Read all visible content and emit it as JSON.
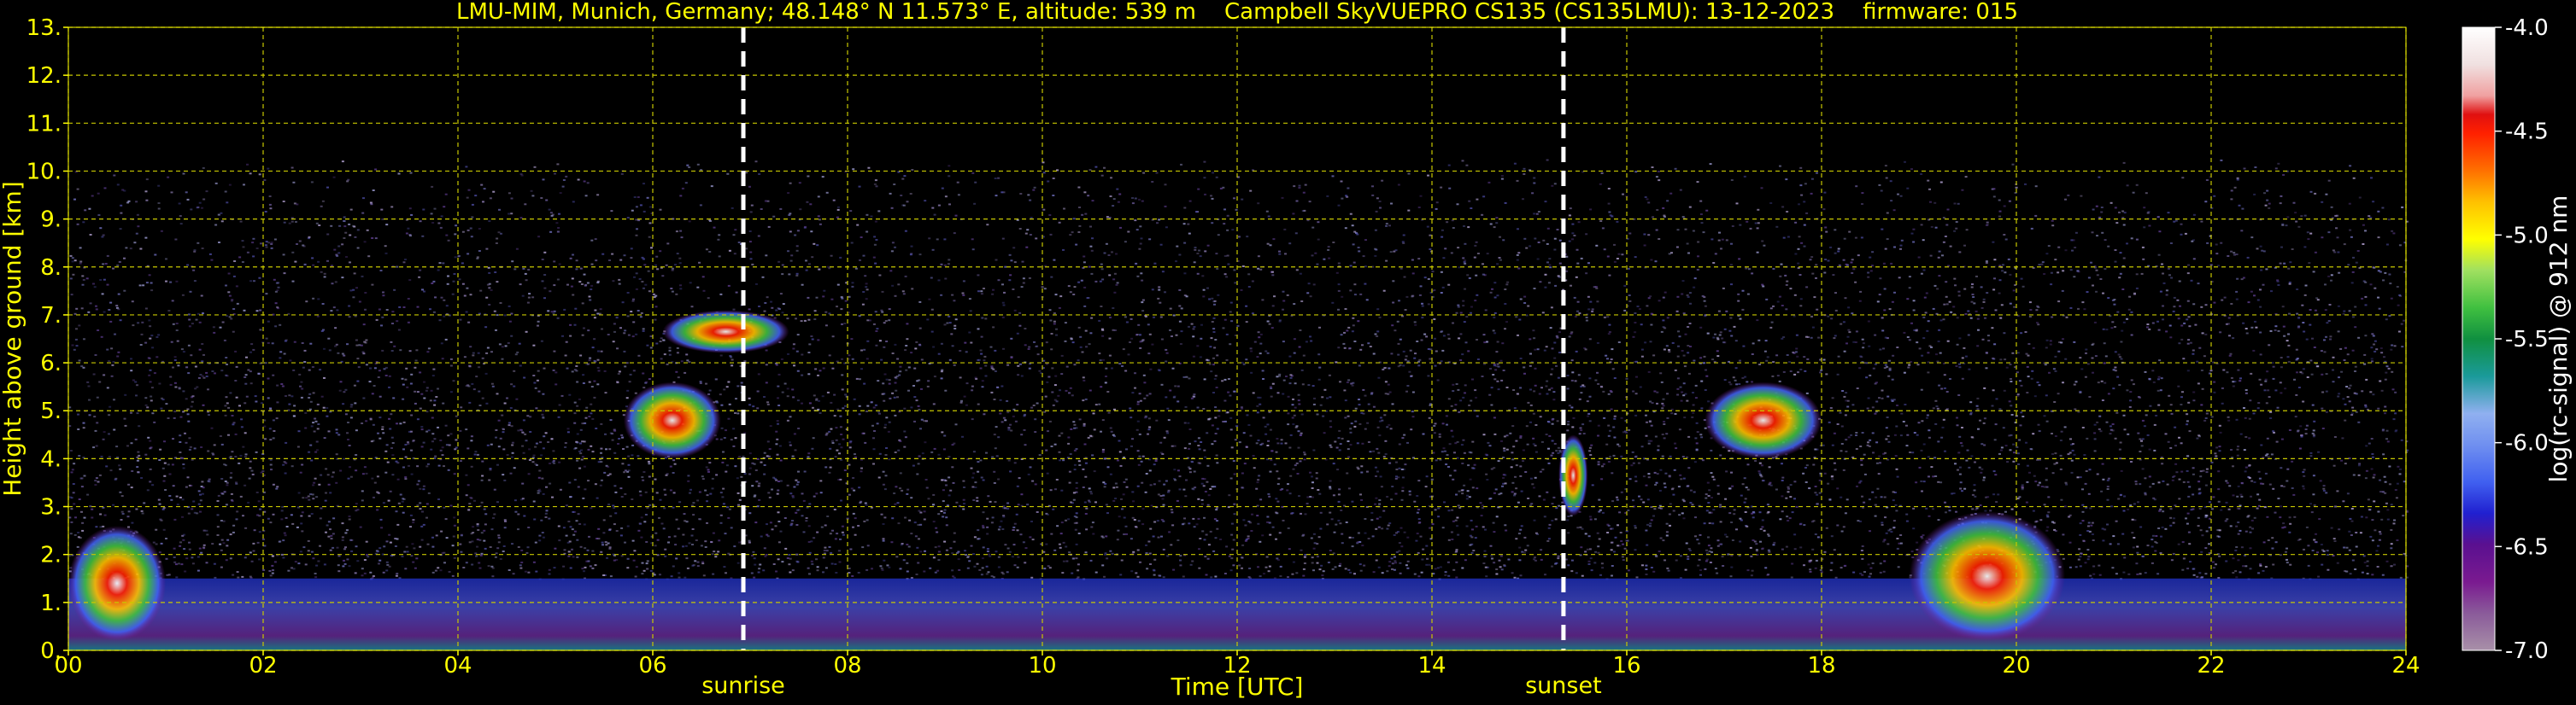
{
  "chart_data": {
    "type": "heatmap",
    "title": "LMU-MIM, Munich, Germany; 48.148° N 11.573° E, altitude: 539 m    Campbell SkyVUEPRO CS135 (CS135LMU): 13-12-2023    firmware: 015",
    "xlabel": "Time [UTC]",
    "ylabel": "Height above ground [km]",
    "xlim": [
      0,
      24
    ],
    "ylim": [
      0,
      13
    ],
    "x_ticks": [
      "00",
      "02",
      "04",
      "06",
      "08",
      "10",
      "12",
      "14",
      "16",
      "18",
      "20",
      "22",
      "24"
    ],
    "y_ticks": [
      "0.",
      "1.",
      "2.",
      "3.",
      "4.",
      "5.",
      "6.",
      "7.",
      "8.",
      "9.",
      "10.",
      "11.",
      "12.",
      "13."
    ],
    "grid": true,
    "annotations": [
      {
        "text": "sunrise",
        "x": 6.93
      },
      {
        "text": "sunset",
        "x": 15.35
      }
    ],
    "colorbar": {
      "label": "log(rc-signal) @ 912 nm",
      "range": [
        -7.0,
        -4.0
      ],
      "ticks": [
        "-4.0",
        "-4.5",
        "-5.0",
        "-5.5",
        "-6.0",
        "-6.5",
        "-7.0"
      ]
    },
    "signal_top_km": 10.25,
    "features": [
      {
        "feature": "boundary layer aerosol",
        "x": [
          0,
          24
        ],
        "y": [
          0,
          1.5
        ]
      },
      {
        "feature": "cloud layer",
        "x": [
          6.1,
          7.4
        ],
        "y": [
          6.2,
          7.1
        ]
      },
      {
        "feature": "cloud layer",
        "x": [
          5.7,
          6.7
        ],
        "y": [
          4.0,
          5.6
        ]
      },
      {
        "feature": "cloud layer",
        "x": [
          15.3,
          15.6
        ],
        "y": [
          2.8,
          4.5
        ]
      },
      {
        "feature": "cloud layer",
        "x": [
          16.8,
          18.0
        ],
        "y": [
          4.0,
          5.6
        ]
      },
      {
        "feature": "cloud layer",
        "x": [
          18.9,
          20.5
        ],
        "y": [
          0.2,
          2.9
        ]
      },
      {
        "feature": "cloud layer",
        "x": [
          0,
          1.0
        ],
        "y": [
          0.2,
          2.6
        ]
      }
    ],
    "colors": {
      "background": "#000000",
      "text": "#ffff00",
      "grid": "#c8c800",
      "marker": "#ffffff"
    }
  }
}
